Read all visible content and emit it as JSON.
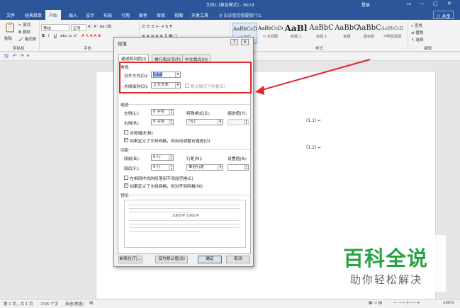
{
  "window": {
    "title": "文档1 [兼容模式] - Word",
    "login": "登录",
    "buttons": [
      "—",
      "▢",
      "✕"
    ]
  },
  "menu": {
    "tabs": [
      "文件",
      "经典菜单",
      "开始",
      "插入",
      "设计",
      "布局",
      "引用",
      "邮件",
      "审阅",
      "视图",
      "开发工具"
    ],
    "active_tab": "开始",
    "tell_me": "告诉我您想要做什么",
    "share": "共享"
  },
  "ribbon": {
    "clipboard": {
      "paste": "粘贴",
      "cut": "剪切",
      "copy": "复制",
      "format_painter": "格式刷",
      "group": "剪贴板"
    },
    "font": {
      "name": "等线",
      "size": "五号",
      "group": "字体",
      "bold": "B",
      "italic": "I",
      "underline": "U"
    },
    "paragraph": {
      "group": "段落"
    },
    "styles": {
      "group": "样式",
      "items": [
        {
          "sample": "AaBbCcDc",
          "name": "↵ 正文"
        },
        {
          "sample": "AaBbCcDc",
          "name": "↵ 无间隔"
        },
        {
          "sample": "AaBl",
          "name": "标题 1"
        },
        {
          "sample": "AaBbC",
          "name": "标题 2"
        },
        {
          "sample": "AaBbC",
          "name": "标题"
        },
        {
          "sample": "AaBbC",
          "name": "副标题"
        },
        {
          "sample": "AaBbCcD",
          "name": "不明显强调"
        }
      ]
    },
    "editing": {
      "find": "查找",
      "replace": "替换",
      "select": "选择",
      "group": "编辑"
    }
  },
  "document": {
    "equations": [
      "(1.1) ↵",
      "(1.2) ↵"
    ]
  },
  "status": {
    "page": "第 1 页，共 1 页",
    "words": "7/35 个字",
    "lang": "英语(美国)",
    "zoom": "100%"
  },
  "dialog": {
    "title": "段落",
    "help": "?",
    "close": "✕",
    "tabs": [
      "缩进和间距(I)",
      "换行和分页(P)",
      "中文版式(H)"
    ],
    "general": {
      "section": "常规",
      "alignment_label": "对齐方式(G):",
      "alignment_value": "居中",
      "outline_label": "大纲级别(O):",
      "outline_value": "正文文本",
      "collapsed_label": "默认情况下折叠(E)"
    },
    "indent": {
      "section": "缩进",
      "left_label": "左侧(L):",
      "left_value": "0 字符",
      "right_label": "右侧(R):",
      "right_value": "0 字符",
      "special_label": "特殊格式(S):",
      "special_value": "(无)",
      "by_label": "缩进值(Y):",
      "mirror_label": "对称缩进(M)",
      "grid_label": "如果定义了文档网格，则自动调整右缩进(D)"
    },
    "spacing": {
      "section": "间距",
      "before_label": "段前(B):",
      "before_value": "0 行",
      "after_label": "段后(F):",
      "after_value": "0 行",
      "line_label": "行距(N):",
      "line_value": "单倍行距",
      "at_label": "设置值(A):",
      "nospace_label": "在相同样式的段落间不添加空格(C)",
      "snap_label": "如果定义了文档网格，则对齐到网格(W)"
    },
    "preview": {
      "section": "预览",
      "sample": "示例文字 示例文字"
    },
    "buttons": {
      "tabs": "制表位(T)...",
      "default": "设为默认值(D)",
      "ok": "确定",
      "cancel": "取消"
    }
  },
  "watermark": {
    "line1": "百科全说",
    "line2": "助你轻松解决"
  },
  "colors": {
    "accent": "#2b579a",
    "annotation": "#e0262a",
    "watermark": "#27a344"
  }
}
